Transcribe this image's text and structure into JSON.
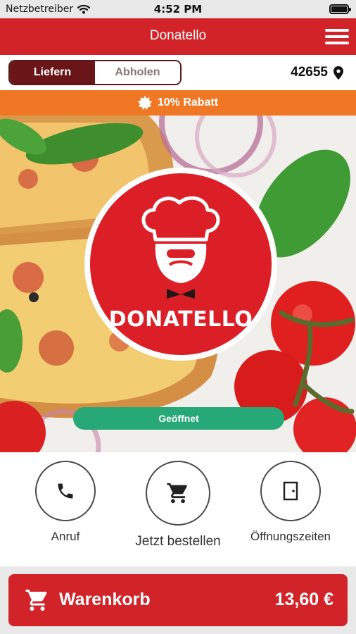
{
  "status_bar": {
    "carrier": "Netzbetreiber",
    "time": "4:52 PM"
  },
  "app_bar": {
    "title": "Donatello"
  },
  "mode_toggle": {
    "options": [
      "Liefern",
      "Abholen"
    ],
    "selected": "Liefern"
  },
  "location": {
    "zip": "42655"
  },
  "discount": {
    "text": "10% Rabatt"
  },
  "hero": {
    "logo_text": "DONATELLO",
    "status": "Geöffnet"
  },
  "actions": [
    {
      "label": "Anruf",
      "icon": "phone-icon"
    },
    {
      "label": "Jetzt bestellen",
      "icon": "cart-icon"
    },
    {
      "label": "Öffnungszeiten",
      "icon": "door-icon"
    }
  ],
  "cart": {
    "label": "Warenkorb",
    "total": "13,60 €"
  },
  "colors": {
    "brand_red": "#d22329",
    "dark_red": "#6a1518",
    "orange": "#f07825",
    "open_green": "#27a877"
  }
}
